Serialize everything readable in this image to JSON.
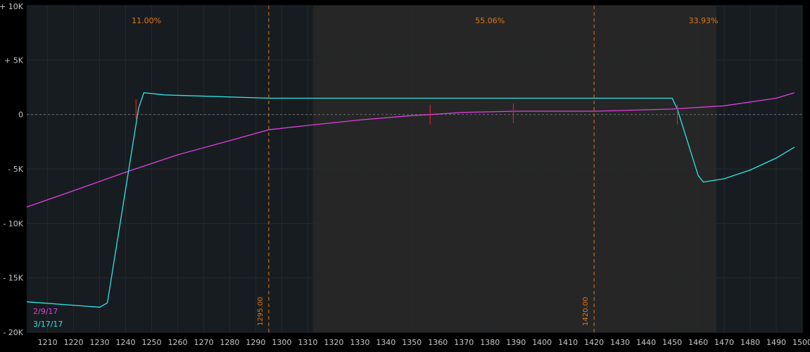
{
  "chart_data": {
    "type": "line",
    "xlabel": "",
    "ylabel": "",
    "xlim": [
      1202,
      1500
    ],
    "ylim": [
      -20000,
      10000
    ],
    "x_ticks": [
      1210,
      1220,
      1230,
      1240,
      1250,
      1260,
      1270,
      1280,
      1290,
      1300,
      1310,
      1320,
      1330,
      1340,
      1350,
      1360,
      1370,
      1380,
      1390,
      1400,
      1410,
      1420,
      1430,
      1440,
      1450,
      1460,
      1470,
      1480,
      1490,
      1500
    ],
    "x_tick_labels": [
      "1210",
      "1220",
      "1230",
      "1240",
      "1250",
      "1260",
      "1270",
      "1280",
      "1290",
      "1300",
      "1310",
      "1320",
      "1330",
      "1340",
      "1350",
      "1360",
      "1370",
      "1380",
      "1390",
      "1400",
      "1410",
      "1420",
      "1430",
      "1440",
      "1450",
      "1460",
      "1470",
      "1480",
      "1490",
      "1500"
    ],
    "y_ticks": [
      10000,
      5000,
      0,
      -5000,
      -10000,
      -15000,
      -20000
    ],
    "y_tick_labels": [
      "+ 10K",
      "+ 5K",
      "0",
      "- 5K",
      "- 10K",
      "- 15K",
      "- 20K"
    ],
    "zero_line": 0,
    "probability_regions": [
      {
        "label": "11.00%",
        "from": 1202,
        "to": 1312,
        "label_x": 1248
      },
      {
        "label": "55.06%",
        "from": 1312,
        "to": 1467,
        "label_x": 1380
      },
      {
        "label": "33.93%",
        "from": 1467,
        "to": 1500,
        "label_x": 1462
      }
    ],
    "vertical_markers": [
      {
        "x": 1295,
        "label": "1295.00"
      },
      {
        "x": 1420,
        "label": "1420.00"
      }
    ],
    "series": [
      {
        "name": "2/9/17",
        "color": "#e040e0",
        "x": [
          1202,
          1220,
          1240,
          1260,
          1280,
          1295,
          1310,
          1330,
          1350,
          1357,
          1370,
          1390,
          1420,
          1450,
          1470,
          1490,
          1497
        ],
        "y": [
          -8500,
          -7000,
          -5300,
          -3700,
          -2400,
          -1400,
          -1000,
          -500,
          -100,
          0,
          200,
          300,
          300,
          500,
          800,
          1500,
          2000
        ]
      },
      {
        "name": "3/17/17",
        "color": "#2ee6e6",
        "x": [
          1202,
          1230,
          1233,
          1245,
          1247,
          1255,
          1295,
          1350,
          1420,
          1450,
          1452,
          1460,
          1462,
          1470,
          1480,
          1490,
          1497
        ],
        "y": [
          -17200,
          -17700,
          -17300,
          600,
          2000,
          1800,
          1500,
          1500,
          1500,
          1500,
          500,
          -5600,
          -6200,
          -5900,
          -5100,
          -4000,
          -3000
        ]
      }
    ],
    "markers": [
      {
        "x": 1244,
        "y": 500,
        "color": "#e02020"
      },
      {
        "x": 1357,
        "y": 0,
        "color": "#e02020"
      },
      {
        "x": 1389,
        "y": 100,
        "color": "#e02020"
      },
      {
        "x": 1452,
        "y": 0,
        "color": "#e02020"
      }
    ],
    "colors": {
      "background": "#000000",
      "plot_bg": "#171c20",
      "middle_region": "#262626",
      "grid": "#232a2e",
      "zero_line": "#6a6a6a",
      "marker_line": "#e07818"
    }
  }
}
